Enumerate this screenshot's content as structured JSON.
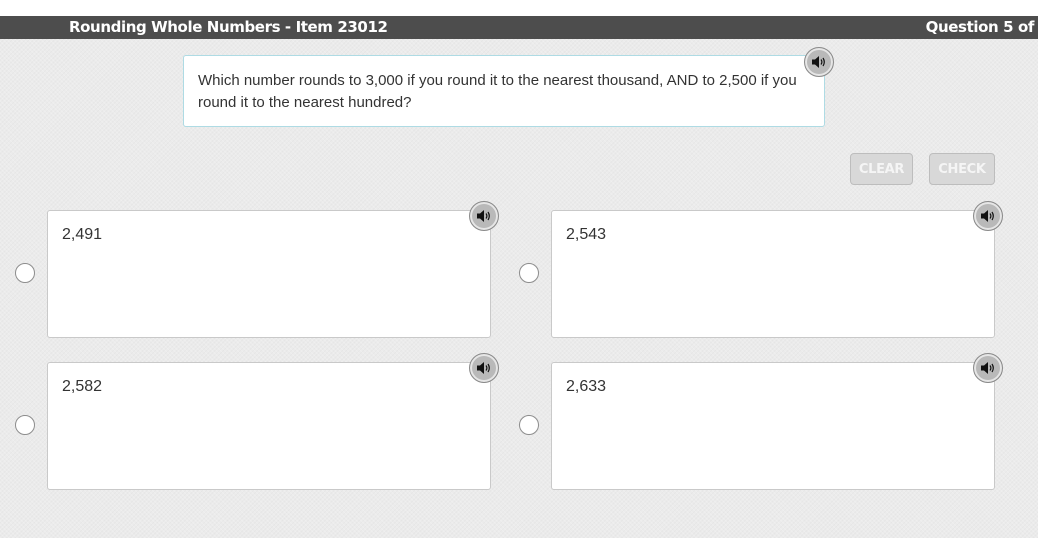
{
  "header": {
    "title": "Rounding Whole Numbers - Item 23012",
    "progress": "Question 5 of"
  },
  "question": {
    "text": "Which number rounds to 3,000 if you round it to the nearest thousand, AND to 2,500 if you round it to the nearest hundred?",
    "audio_icon": "speaker-icon"
  },
  "actions": {
    "clear_label": "CLEAR",
    "check_label": "CHECK"
  },
  "options": [
    {
      "label": "2,491",
      "selected": false
    },
    {
      "label": "2,543",
      "selected": false
    },
    {
      "label": "2,582",
      "selected": false
    },
    {
      "label": "2,633",
      "selected": false
    }
  ],
  "colors": {
    "header_bg": "#4d4d4d",
    "page_bg": "#ebebeb",
    "question_border": "#aedbe4",
    "button_disabled_bg": "#d8d8d8"
  }
}
